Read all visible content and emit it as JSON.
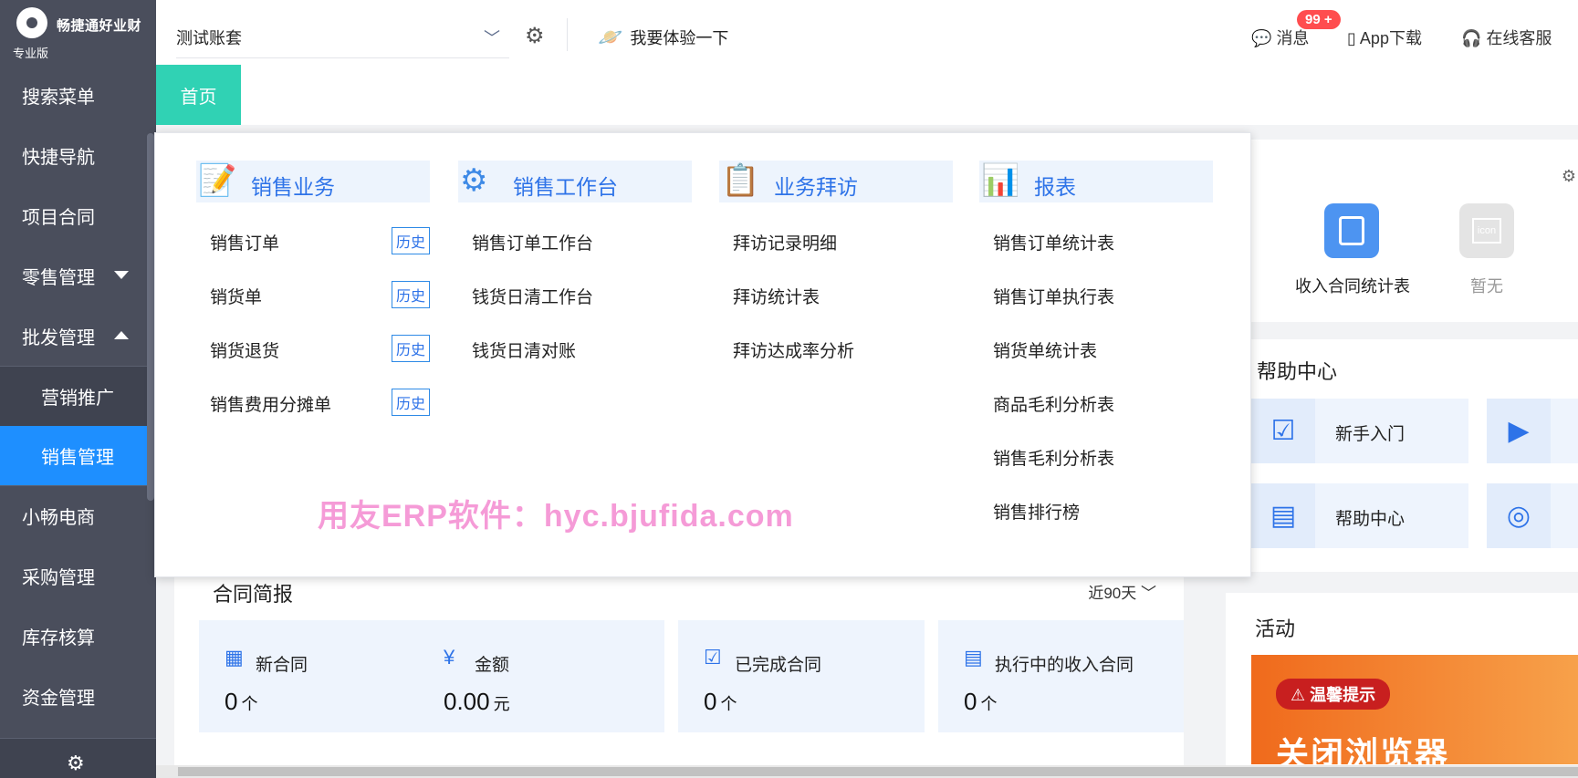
{
  "sidebar": {
    "brand": "畅捷通好业财",
    "edition": "专业版",
    "items": [
      {
        "label": "搜索菜单"
      },
      {
        "label": "快捷导航"
      },
      {
        "label": "项目合同"
      },
      {
        "label": "零售管理"
      },
      {
        "label": "批发管理"
      }
    ],
    "sub_items": [
      {
        "label": "营销推广"
      },
      {
        "label": "销售管理"
      }
    ],
    "items_after": [
      {
        "label": "小畅电商"
      },
      {
        "label": "采购管理"
      },
      {
        "label": "库存核算"
      },
      {
        "label": "资金管理"
      }
    ]
  },
  "topbar": {
    "account": "测试账套",
    "try_label": "我要体验一下",
    "messages_label": "消息",
    "badge": "99 +",
    "app_label": "App下载",
    "service_label": "在线客服"
  },
  "tabs": {
    "home": "首页"
  },
  "quick": {
    "item1": "收入合同统计表",
    "item2": "暂无",
    "placeholder_icon": "icon"
  },
  "help": {
    "title": "帮助中心",
    "items": [
      {
        "label": "新手入门"
      },
      {
        "label": "帮助中心"
      }
    ]
  },
  "contract": {
    "title": "合同简报",
    "range": "近90天",
    "stats": [
      {
        "label": "新合同",
        "value": "0",
        "unit": "个"
      },
      {
        "label": "金额",
        "value": "0.00",
        "unit": "元"
      },
      {
        "label": "已完成合同",
        "value": "0",
        "unit": "个"
      },
      {
        "label": "执行中的收入合同",
        "value": "0",
        "unit": "个"
      }
    ]
  },
  "activity": {
    "title": "活动",
    "pill": "温馨提示",
    "banner": "关闭浏览器"
  },
  "panel": {
    "watermark": "用友ERP软件：hyc.bjufida.com",
    "history_label": "历史",
    "columns": [
      {
        "title": "销售业务",
        "items": [
          {
            "label": "销售订单",
            "history": true
          },
          {
            "label": "销货单",
            "history": true
          },
          {
            "label": "销货退货",
            "history": true
          },
          {
            "label": "销售费用分摊单",
            "history": true
          }
        ]
      },
      {
        "title": "销售工作台",
        "items": [
          {
            "label": "销售订单工作台"
          },
          {
            "label": "钱货日清工作台"
          },
          {
            "label": "钱货日清对账"
          }
        ]
      },
      {
        "title": "业务拜访",
        "items": [
          {
            "label": "拜访记录明细"
          },
          {
            "label": "拜访统计表"
          },
          {
            "label": "拜访达成率分析"
          }
        ]
      },
      {
        "title": "报表",
        "items": [
          {
            "label": "销售订单统计表"
          },
          {
            "label": "销售订单执行表"
          },
          {
            "label": "销货单统计表"
          },
          {
            "label": "商品毛利分析表"
          },
          {
            "label": "销售毛利分析表"
          },
          {
            "label": "销售排行榜"
          }
        ]
      }
    ]
  }
}
